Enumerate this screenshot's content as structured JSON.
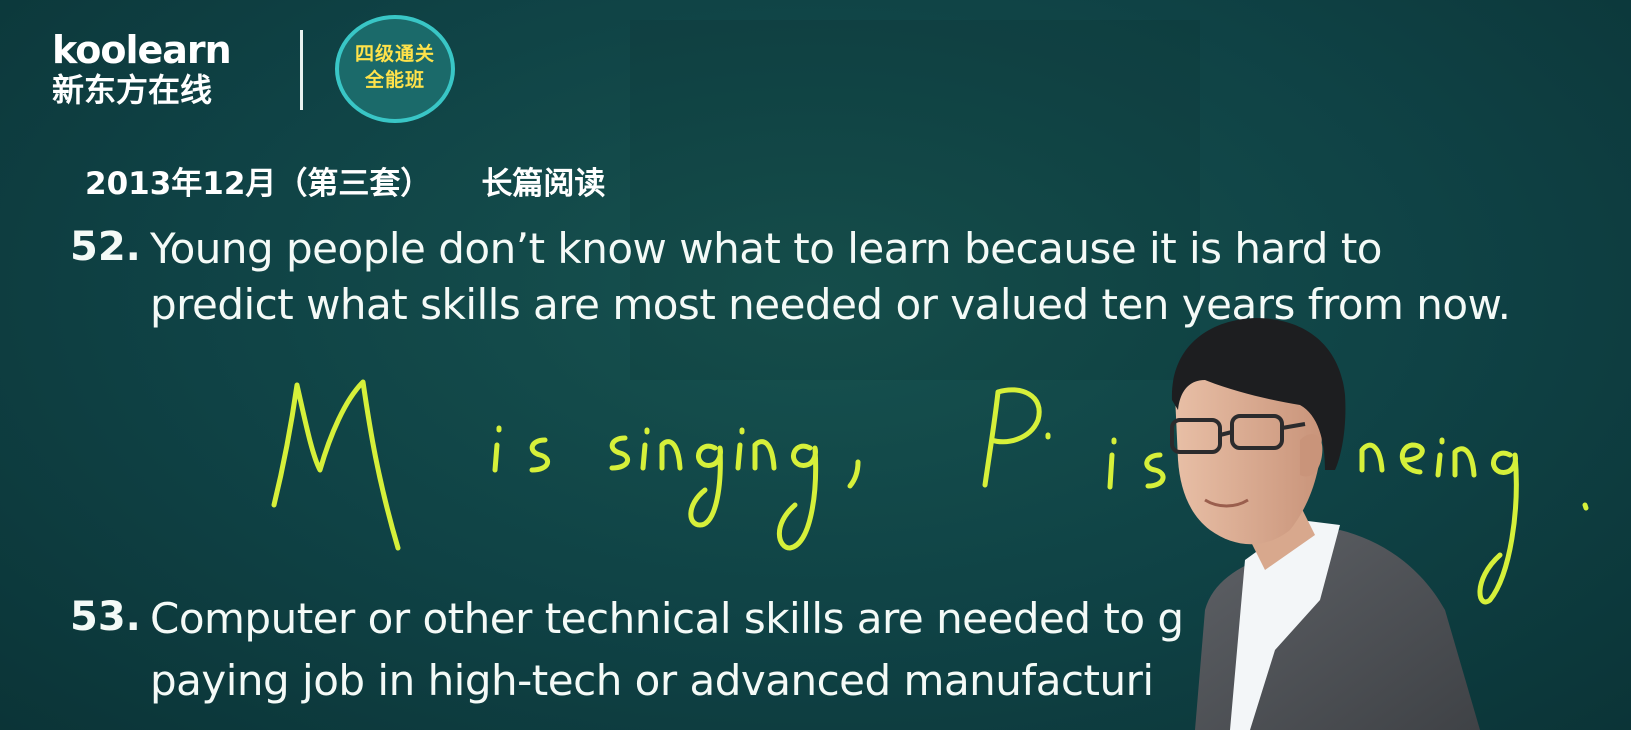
{
  "brand": {
    "logo_text": "koolearn",
    "logo_cn": "新东方在线",
    "badge_line1": "四级通关",
    "badge_line2": "全能班"
  },
  "header": {
    "exam": "2013年12月（第三套）",
    "section": "长篇阅读"
  },
  "questions": [
    {
      "number": "52.",
      "line1": "Young people don’t know what to learn because it is hard to",
      "line2": "predict what skills are most needed or valued ten years from now."
    },
    {
      "number": "53.",
      "line1": "Computer or other technical skills are needed to g",
      "line2": "paying job in high-tech or advanced manufacturi"
    }
  ],
  "handwriting": "M is singing, P. is dancing.",
  "colors": {
    "board": "#0f4245",
    "chalk_yellow": "#d6f03a",
    "text": "#f4faf7",
    "badge_ring": "#39c6c6",
    "badge_text": "#ffe24a"
  }
}
